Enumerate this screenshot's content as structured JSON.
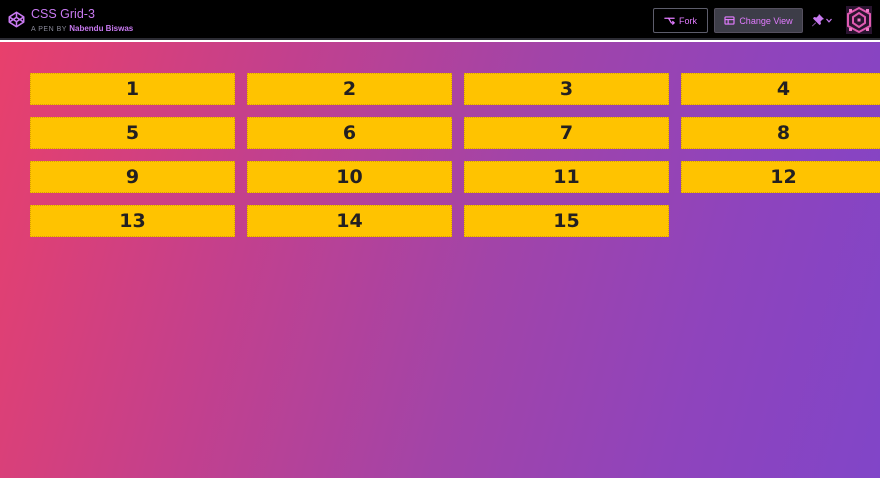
{
  "header": {
    "title": "CSS Grid-3",
    "byline_prefix": "A PEN BY",
    "author": "Nabendu Biswas",
    "fork_label": "Fork",
    "change_view_label": "Change View",
    "logo_icon": "codepen-logo-icon",
    "fork_icon": "fork-icon",
    "change_view_icon": "layout-icon",
    "pin_icon": "pin-icon",
    "avatar": "user-avatar"
  },
  "grid": {
    "items": [
      "1",
      "2",
      "3",
      "4",
      "5",
      "6",
      "7",
      "8",
      "9",
      "10",
      "11",
      "12",
      "13",
      "14",
      "15"
    ]
  },
  "colors": {
    "header_bg": "#000000",
    "accent": "#c879f0",
    "cell_bg": "#ffc300",
    "cell_text": "#232021",
    "gradient_start": "#e8406c",
    "gradient_end": "#8145c8"
  }
}
